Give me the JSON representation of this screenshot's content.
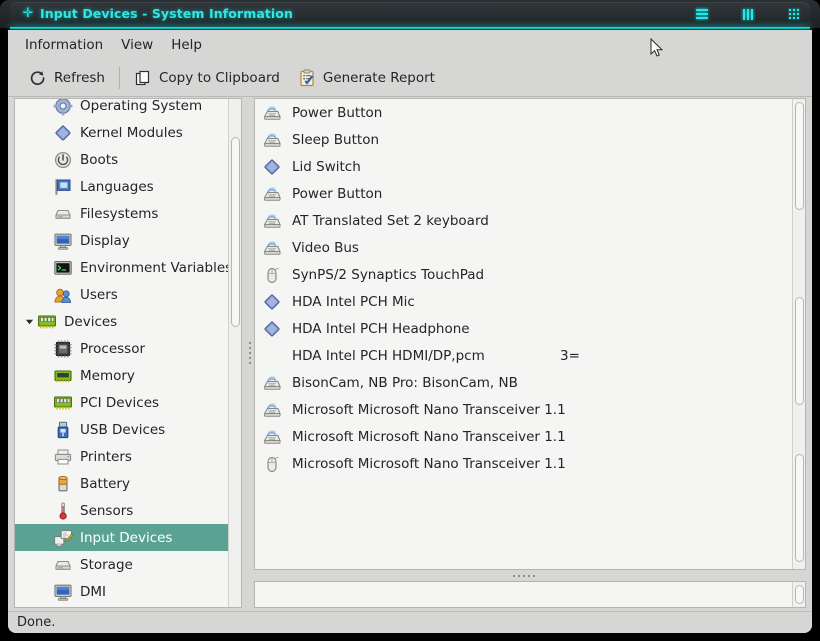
{
  "window": {
    "title": "Input Devices - System Information",
    "title_icon": "plus-icon",
    "accent_color": "#2ee8e4",
    "titlebar_color": "#262b2e",
    "buttons": [
      {
        "name": "minimize-button",
        "label": "Minimize"
      },
      {
        "name": "maximize-button",
        "label": "Maximize"
      },
      {
        "name": "close-button",
        "label": "Close"
      }
    ]
  },
  "menubar": {
    "items": [
      {
        "label": "Information",
        "name": "menu-information"
      },
      {
        "label": "View",
        "name": "menu-view"
      },
      {
        "label": "Help",
        "name": "menu-help"
      }
    ]
  },
  "toolbar": {
    "refresh_label": "Refresh",
    "copy_label": "Copy to Clipboard",
    "report_label": "Generate Report",
    "icons": {
      "refresh": "refresh-icon",
      "copy": "copy-pages-icon",
      "report": "clipboard-check-icon"
    }
  },
  "sidebar": {
    "selection_color": "#5aa394",
    "items": [
      {
        "label": "Operating System",
        "icon": "gear-icon",
        "indent": 1,
        "selected": false,
        "expander": ""
      },
      {
        "label": "Kernel Modules",
        "icon": "diamond-icon",
        "indent": 1,
        "selected": false,
        "expander": ""
      },
      {
        "label": "Boots",
        "icon": "power-icon",
        "indent": 1,
        "selected": false,
        "expander": ""
      },
      {
        "label": "Languages",
        "icon": "flag-icon",
        "indent": 1,
        "selected": false,
        "expander": ""
      },
      {
        "label": "Filesystems",
        "icon": "drive-icon",
        "indent": 1,
        "selected": false,
        "expander": ""
      },
      {
        "label": "Display",
        "icon": "monitor-icon",
        "indent": 1,
        "selected": false,
        "expander": ""
      },
      {
        "label": "Environment Variables",
        "icon": "terminal-icon",
        "indent": 1,
        "selected": false,
        "expander": ""
      },
      {
        "label": "Users",
        "icon": "users-icon",
        "indent": 1,
        "selected": false,
        "expander": ""
      },
      {
        "label": "Devices",
        "icon": "pcicard-icon",
        "indent": 0,
        "selected": false,
        "expander": "expanded"
      },
      {
        "label": "Processor",
        "icon": "cpu-icon",
        "indent": 1,
        "selected": false,
        "expander": ""
      },
      {
        "label": "Memory",
        "icon": "memory-icon",
        "indent": 1,
        "selected": false,
        "expander": ""
      },
      {
        "label": "PCI Devices",
        "icon": "pcicard-icon",
        "indent": 1,
        "selected": false,
        "expander": ""
      },
      {
        "label": "USB Devices",
        "icon": "usb-icon",
        "indent": 1,
        "selected": false,
        "expander": ""
      },
      {
        "label": "Printers",
        "icon": "printer-icon",
        "indent": 1,
        "selected": false,
        "expander": ""
      },
      {
        "label": "Battery",
        "icon": "battery-icon",
        "indent": 1,
        "selected": false,
        "expander": ""
      },
      {
        "label": "Sensors",
        "icon": "thermometer-icon",
        "indent": 1,
        "selected": false,
        "expander": ""
      },
      {
        "label": "Input Devices",
        "icon": "input-devices-icon",
        "indent": 1,
        "selected": true,
        "expander": ""
      },
      {
        "label": "Storage",
        "icon": "drive-icon",
        "indent": 1,
        "selected": false,
        "expander": ""
      },
      {
        "label": "DMI",
        "icon": "monitor-icon",
        "indent": 1,
        "selected": false,
        "expander": ""
      }
    ]
  },
  "device_list": {
    "rows": [
      {
        "label": "Power Button",
        "icon": "keyboard-icon",
        "extra": ""
      },
      {
        "label": "Sleep Button",
        "icon": "keyboard-icon",
        "extra": ""
      },
      {
        "label": "Lid Switch",
        "icon": "diamond-icon",
        "extra": ""
      },
      {
        "label": "Power Button",
        "icon": "keyboard-icon",
        "extra": ""
      },
      {
        "label": "AT Translated Set 2 keyboard",
        "icon": "keyboard-icon",
        "extra": ""
      },
      {
        "label": "Video Bus",
        "icon": "keyboard-icon",
        "extra": ""
      },
      {
        "label": "SynPS/2 Synaptics TouchPad",
        "icon": "mouse-icon",
        "extra": ""
      },
      {
        "label": "HDA Intel PCH Mic",
        "icon": "diamond-icon",
        "extra": ""
      },
      {
        "label": "HDA Intel PCH Headphone",
        "icon": "diamond-icon",
        "extra": ""
      },
      {
        "label": "HDA Intel PCH HDMI/DP,pcm",
        "icon": "none",
        "extra": "3="
      },
      {
        "label": "BisonCam, NB Pro: BisonCam, NB",
        "icon": "keyboard-icon",
        "extra": ""
      },
      {
        "label": "Microsoft Microsoft Nano Transceiver 1.1",
        "icon": "keyboard-icon",
        "extra": ""
      },
      {
        "label": "Microsoft Microsoft Nano Transceiver 1.1",
        "icon": "keyboard-icon",
        "extra": ""
      },
      {
        "label": "Microsoft Microsoft Nano Transceiver 1.1",
        "icon": "mouse-icon",
        "extra": ""
      }
    ]
  },
  "bottom_panel": {
    "content": ""
  },
  "statusbar": {
    "text": "Done."
  }
}
